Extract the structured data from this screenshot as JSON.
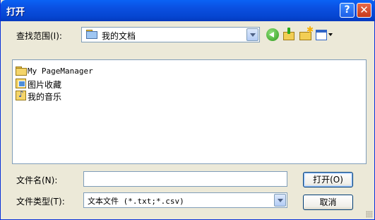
{
  "window": {
    "title": "打开"
  },
  "titlebar_buttons": {
    "help": "?",
    "close": "✕"
  },
  "lookin": {
    "label": "查找范围(I):",
    "value": "我的文档"
  },
  "toolbar": {
    "icons": [
      "back-icon",
      "up-folder-icon",
      "new-folder-icon",
      "view-menu-icon"
    ]
  },
  "files": [
    {
      "name": "My PageManager",
      "icon": "folder-icon"
    },
    {
      "name": "图片收藏",
      "icon": "pictures-folder-icon"
    },
    {
      "name": "我的音乐",
      "icon": "music-folder-icon"
    }
  ],
  "filename": {
    "label": "文件名(N):",
    "value": ""
  },
  "filetype": {
    "label": "文件类型(T):",
    "value": "文本文件 (*.txt;*.csv)"
  },
  "buttons": {
    "open": "打开(O)",
    "cancel": "取消"
  },
  "colors": {
    "titlebar": "#0a52e0",
    "dialog_bg": "#ece9d8",
    "field_border": "#7f9db9"
  }
}
